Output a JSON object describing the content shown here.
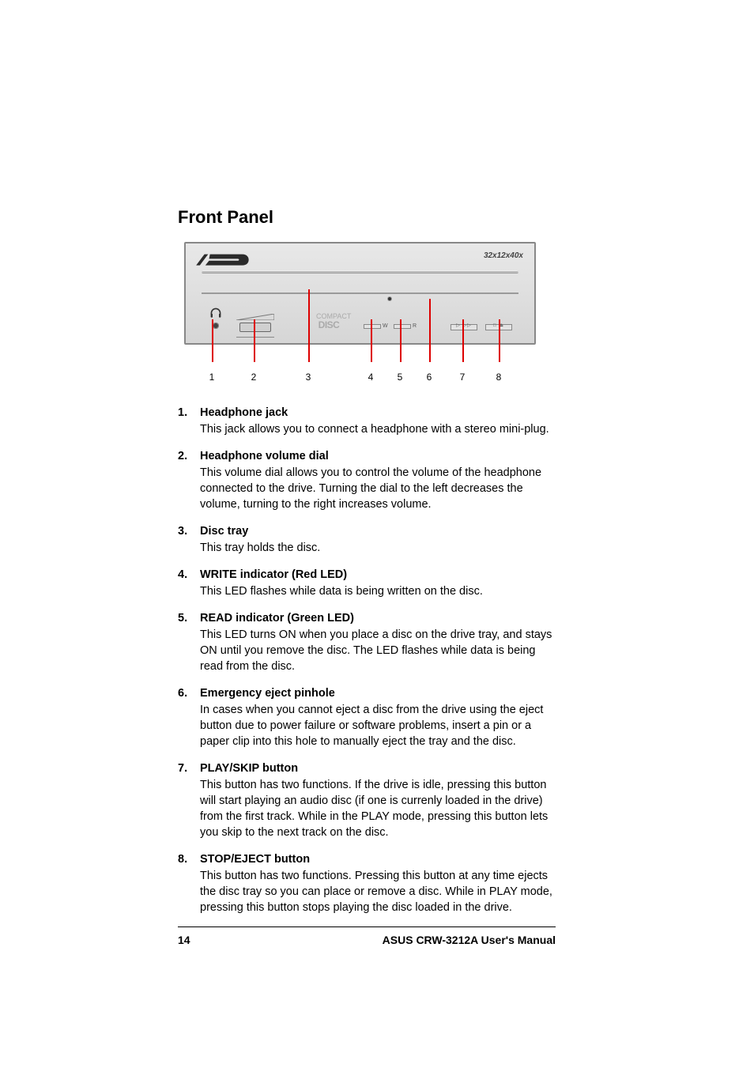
{
  "heading": "Front Panel",
  "device": {
    "speed_label": "32x12x40x",
    "led_w": "W",
    "led_r": "R"
  },
  "cd_logo_line1": "COMPACT",
  "cd_logo_line2": "DISC",
  "callouts": [
    "1",
    "2",
    "3",
    "4",
    "5",
    "6",
    "7",
    "8"
  ],
  "items": [
    {
      "num": "1.",
      "title": "Headphone jack",
      "desc": "This jack allows you to connect a headphone with a stereo mini-plug."
    },
    {
      "num": "2.",
      "title": "Headphone volume dial",
      "desc": "This volume dial allows you to control the volume of the headphone connected to the drive. Turning the dial to the left decreases the volume, turning  to the right increases volume."
    },
    {
      "num": "3.",
      "title": "Disc tray",
      "desc": "This tray holds the disc."
    },
    {
      "num": "4.",
      "title": "WRITE indicator (Red LED)",
      "desc": "This LED flashes while data is being written on the disc."
    },
    {
      "num": "5.",
      "title": "READ indicator (Green LED)",
      "desc": "This LED turns ON when you place a disc on the drive tray, and stays ON until you remove the disc. The LED flashes while data is being read from the disc."
    },
    {
      "num": "6.",
      "title": "Emergency eject pinhole",
      "desc": "In cases when you cannot eject a disc from the drive using the eject button due to power failure or software problems, insert a pin or a paper clip into this hole to manually eject the tray and the disc."
    },
    {
      "num": "7.",
      "title": "PLAY/SKIP button",
      "desc": "This button has two functions. If the drive is idle, pressing this button will start playing an audio disc (if one is currenly loaded in the drive) from the first track. While in the PLAY mode, pressing this button lets you skip to the next track on the disc."
    },
    {
      "num": "8.",
      "title": "STOP/EJECT button",
      "desc": "This button has two functions. Pressing this button at any time ejects the disc tray so you can place or remove a disc. While in PLAY mode, pressing this button stops playing the disc loaded in the drive."
    }
  ],
  "footer": {
    "page": "14",
    "title": "ASUS CRW-3212A User's  Manual"
  }
}
